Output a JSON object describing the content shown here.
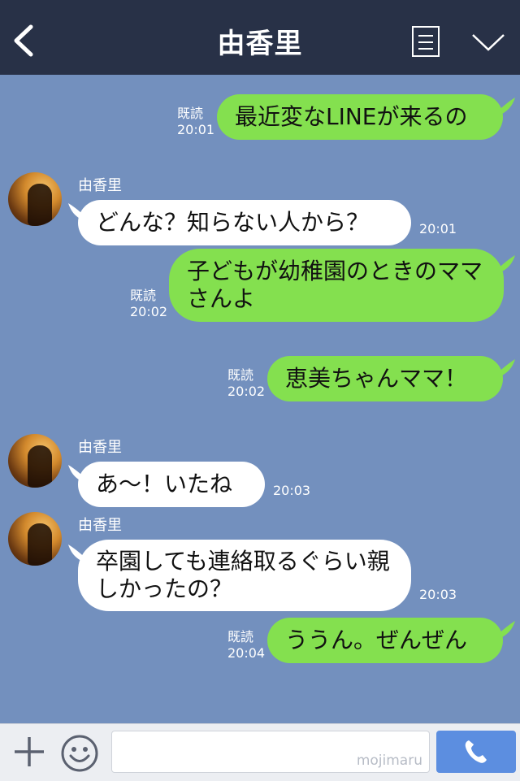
{
  "header": {
    "title": "由香里"
  },
  "messages": [
    {
      "side": "sent",
      "read": "既読",
      "time": "20:01",
      "text": "最近変なLINEが来るの"
    },
    {
      "side": "recv",
      "sender": "由香里",
      "time": "20:01",
      "text": "どんな？知らない人から？"
    },
    {
      "side": "sent",
      "read": "既読",
      "time": "20:02",
      "text": "子どもが幼稚園のときのママさんよ"
    },
    {
      "side": "sent",
      "read": "既読",
      "time": "20:02",
      "text": "恵美ちゃんママ！"
    },
    {
      "side": "recv",
      "sender": "由香里",
      "time": "20:03",
      "text": "あ〜！いたね"
    },
    {
      "side": "recv",
      "sender": "由香里",
      "time": "20:03",
      "text": "卒園しても連絡取るぐらい親しかったの？"
    },
    {
      "side": "sent",
      "read": "既読",
      "time": "20:04",
      "text": "ううん。ぜんぜん"
    }
  ],
  "input": {
    "placeholder": "",
    "watermark": "mojimaru"
  },
  "colors": {
    "header": "#283147",
    "background": "#7390be",
    "sent_bubble": "#84e04f",
    "recv_bubble": "#ffffff",
    "call_button": "#5c8ee0"
  },
  "icons": {
    "back": "chevron-left-icon",
    "menu": "menu-icon",
    "collapse": "chevron-down-icon",
    "plus": "plus-icon",
    "emoji": "smile-icon",
    "call": "phone-icon"
  }
}
